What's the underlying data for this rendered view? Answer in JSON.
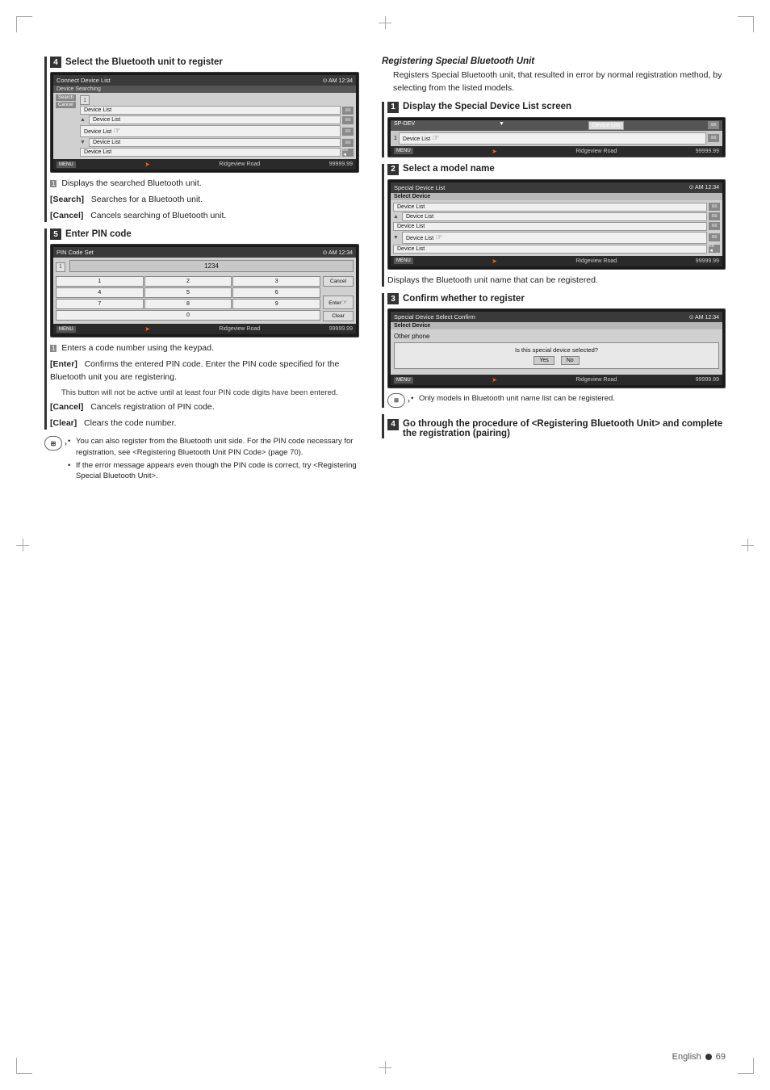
{
  "page": {
    "background": "#ffffff",
    "page_number": "69",
    "page_language": "English"
  },
  "left_column": {
    "step4": {
      "num": "4",
      "title": "Select the Bluetooth unit to register",
      "screen": {
        "topbar": "Connect Device List",
        "subbar": "Device Searching",
        "number_indicator": "1",
        "rows": [
          "Device List",
          "Device List",
          "Device List",
          "Device List",
          "Device List"
        ],
        "buttons": [
          "Search",
          "Cancel"
        ],
        "bottombar": "99999.99",
        "nav_text": "Ridgeview Road"
      },
      "bullets": [
        {
          "indicator": "1",
          "text": "Displays the searched Bluetooth unit."
        },
        {
          "label": "[Search]",
          "text": "Searches for a Bluetooth unit."
        },
        {
          "label": "[Cancel]",
          "text": "Cancels searching of Bluetooth unit."
        }
      ]
    },
    "step5": {
      "num": "5",
      "title": "Enter PIN code",
      "screen": {
        "topbar": "PIN Code Set",
        "number_indicator": "1",
        "pin_display": "1234",
        "keys": [
          "1",
          "2",
          "3",
          "Cancel",
          "4",
          "5",
          "6",
          "",
          "7",
          "8",
          "9",
          "Enter",
          "",
          "0",
          "",
          "Clear"
        ],
        "bottombar": "99999.99",
        "nav_text": "Ridgeview Road"
      },
      "bullets": [
        {
          "indicator": "1",
          "text": "Enters a code number using the keypad."
        },
        {
          "label": "[Enter]",
          "text": "Confirms the entered PIN code. Enter the PIN code specified for the Bluetooth unit you are registering."
        },
        {
          "sub_text": "This button will not be active until at least four PIN code digits have been entered."
        },
        {
          "label": "[Cancel]",
          "text": "Cancels registration of PIN code."
        },
        {
          "label": "[Clear]",
          "text": "Clears the code number."
        }
      ]
    },
    "notes": [
      "You can also register from the Bluetooth unit side. For the PIN code necessary for registration, see <Registering Bluetooth Unit PIN Code> (page 70).",
      "If the error message appears even though the PIN code is correct, try <Registering Special Bluetooth Unit>."
    ]
  },
  "right_column": {
    "italic_title": "Registering Special Bluetooth Unit",
    "description": "Registers Special Bluetooth unit, that resulted in error by normal registration method, by selecting from the listed models.",
    "step1": {
      "num": "1",
      "title": "Display the Special Device List screen",
      "screen": {
        "topbar_left": "SP-DEV",
        "rows": [
          "Device List",
          "Device List"
        ],
        "bottombar": "Ridgeview Road"
      }
    },
    "step2": {
      "num": "2",
      "title": "Select a model name",
      "screen": {
        "topbar": "Special Device List",
        "subbar": "Select Device",
        "rows": [
          "Device List",
          "Device List",
          "Device List",
          "Device List",
          "Device List"
        ],
        "bottombar": "99999.99",
        "nav_text": "Ridgeview Road"
      },
      "text": "Displays the Bluetooth unit name that can be registered."
    },
    "step3": {
      "num": "3",
      "title": "Confirm whether to register",
      "screen": {
        "topbar": "Special Device Select Confirm",
        "subbar": "Select Device",
        "device_name": "Other phone",
        "dialog": "Is this special device selected?",
        "yes_btn": "Yes",
        "no_btn": "No",
        "bottombar": "99999.99",
        "nav_text": "Ridgeview Road"
      },
      "note": "Only models in Bluetooth unit name list can be registered."
    },
    "step4": {
      "num": "4",
      "title": "Go through the procedure of <Registering Bluetooth Unit> and complete the registration (pairing)"
    }
  }
}
